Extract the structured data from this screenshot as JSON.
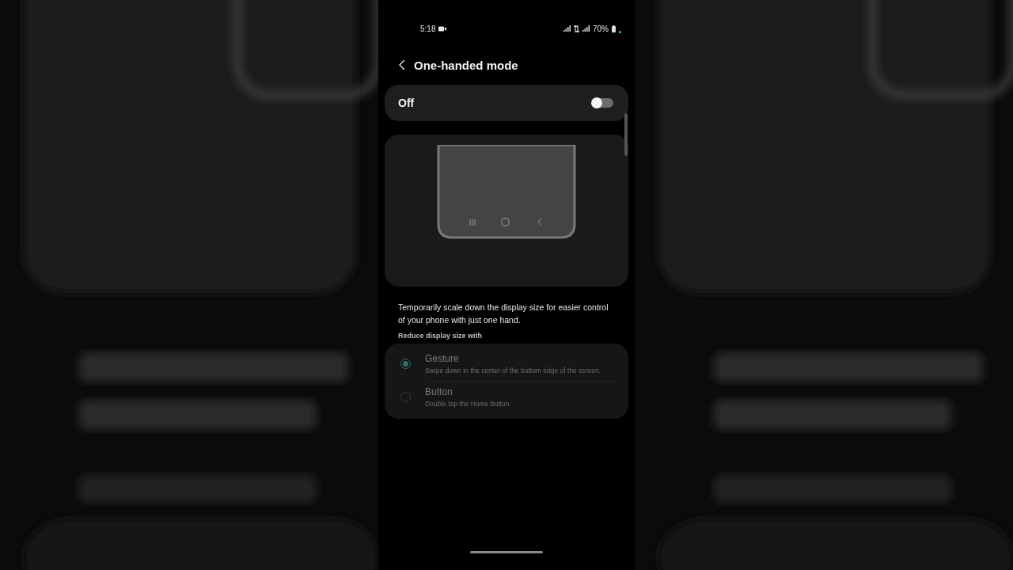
{
  "status_bar": {
    "time": "5:18",
    "battery": "70%"
  },
  "header": {
    "title": "One-handed mode"
  },
  "master_switch": {
    "label": "Off",
    "on": false
  },
  "description": "Temporarily scale down the display size for easier control of your phone with just one hand.",
  "options_section": {
    "title": "Reduce display size with",
    "disabled": true,
    "options": [
      {
        "label": "Gesture",
        "description": "Swipe down in the center of the bottom edge of the screen.",
        "selected": true
      },
      {
        "label": "Button",
        "description": "Double tap the Home button.",
        "selected": false
      }
    ]
  }
}
